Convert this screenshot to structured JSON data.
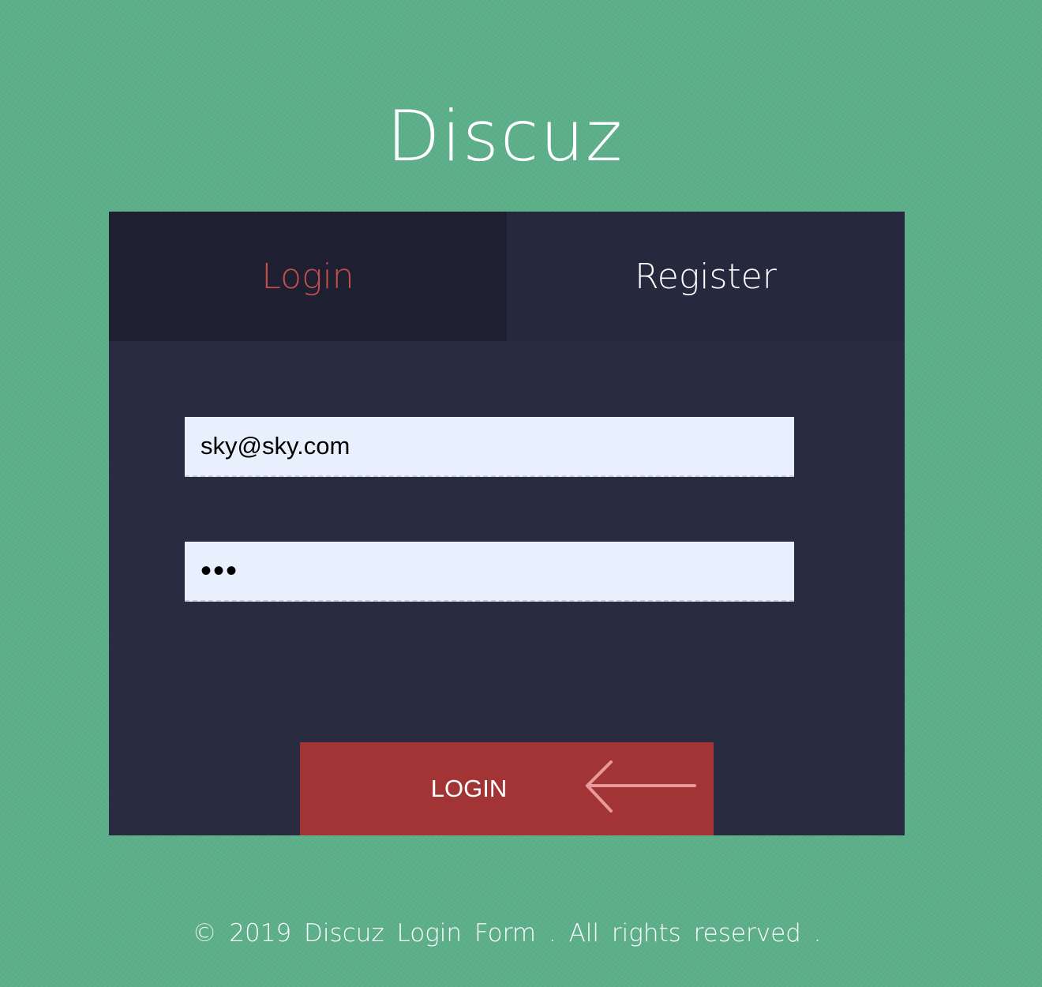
{
  "header": {
    "site_title": "Discuz"
  },
  "tabs": [
    {
      "label": "Login",
      "active": true
    },
    {
      "label": "Register",
      "active": false
    }
  ],
  "form": {
    "email_value": "sky@sky.com",
    "password_value": "•••",
    "login_button_label": "LOGIN",
    "login_button_icon": "arrow-left-icon"
  },
  "footer": {
    "copyright": "© 2019 Discuz Login Form . All rights reserved ."
  },
  "colors": {
    "background": "#5caf89",
    "card": "#292b41",
    "active_tab_text": "#c4504c",
    "button": "#a33436",
    "input_background": "#e8f0fe"
  }
}
